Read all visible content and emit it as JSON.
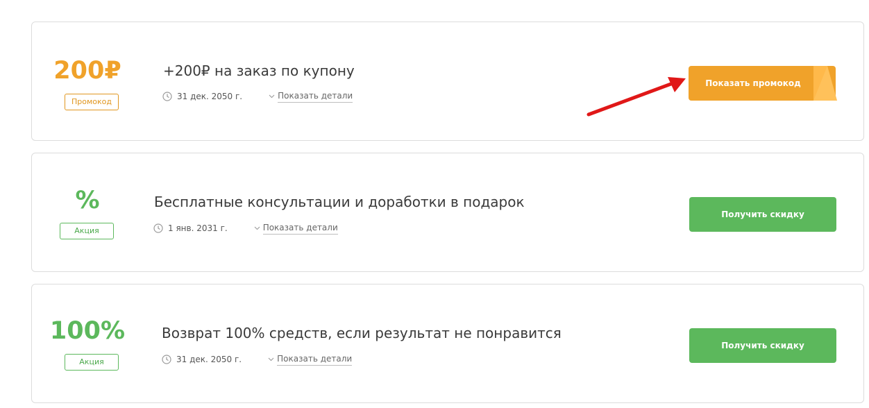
{
  "colors": {
    "orange": "#f0a22a",
    "green": "#5cb85c",
    "red_arrow": "#e01818"
  },
  "offers": [
    {
      "value": "200₽",
      "badge": "Промокод",
      "title": "+200₽ на заказ по купону",
      "date": "31 дек. 2050 г.",
      "details_label": "Показать детали",
      "button_label": "Показать промокод"
    },
    {
      "value": "%",
      "badge": "Акция",
      "title": "Бесплатные консультации и доработки в подарок",
      "date": "1 янв. 2031 г.",
      "details_label": "Показать детали",
      "button_label": "Получить скидку"
    },
    {
      "value": "100%",
      "badge": "Акция",
      "title": "Возврат 100% средств, если результат не понравится",
      "date": "31 дек. 2050 г.",
      "details_label": "Показать детали",
      "button_label": "Получить скидку"
    }
  ],
  "icons": {
    "date": "clock-icon",
    "details": "chevron-down-icon",
    "annotation": "red-arrow-icon"
  }
}
